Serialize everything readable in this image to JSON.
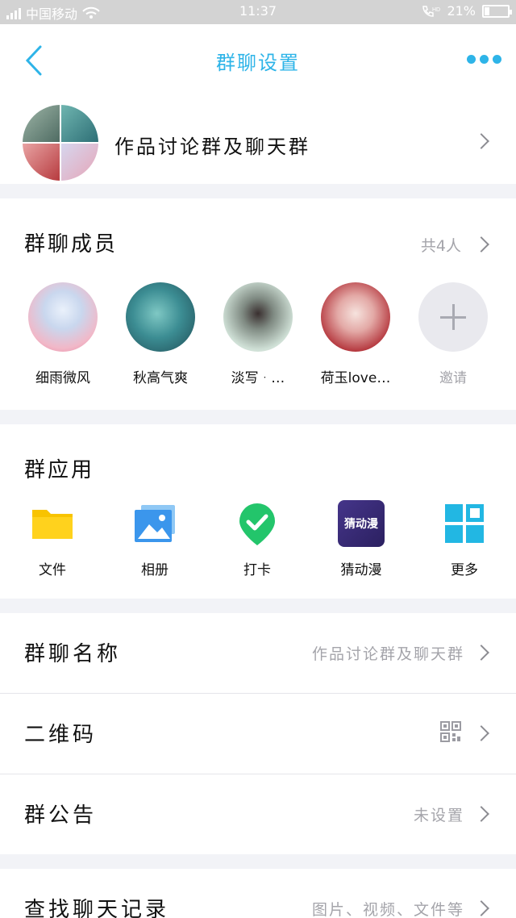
{
  "status_bar": {
    "carrier": "中国移动",
    "time": "11:37",
    "battery": "21%",
    "battery_level": 0.21
  },
  "nav": {
    "title": "群聊设置"
  },
  "group": {
    "name": "作品讨论群及聊天群"
  },
  "members": {
    "title": "群聊成员",
    "count": "共4人",
    "items": [
      {
        "name": "细雨微风"
      },
      {
        "name": "秋高气爽"
      },
      {
        "name": "淡写ᆞ…"
      },
      {
        "name": "荷玉love…"
      }
    ],
    "invite_label": "邀请"
  },
  "apps": {
    "title": "群应用",
    "items": [
      {
        "label": "文件",
        "icon": "folder-icon"
      },
      {
        "label": "相册",
        "icon": "album-icon"
      },
      {
        "label": "打卡",
        "icon": "check-in-icon"
      },
      {
        "label": "猜动漫",
        "icon": "guess-anime-icon",
        "badge": "猜动漫"
      },
      {
        "label": "更多",
        "icon": "more-apps-icon"
      }
    ]
  },
  "settings": {
    "group_name": {
      "label": "群聊名称",
      "value": "作品讨论群及聊天群"
    },
    "qr_code": {
      "label": "二维码"
    },
    "notice": {
      "label": "群公告",
      "value": "未设置"
    },
    "history": {
      "label": "查找聊天记录",
      "value": "图片、视频、文件等"
    }
  },
  "colors": {
    "accent": "#2eb4e8",
    "background": "#f2f3f7",
    "muted_text": "#a4a4aa"
  }
}
